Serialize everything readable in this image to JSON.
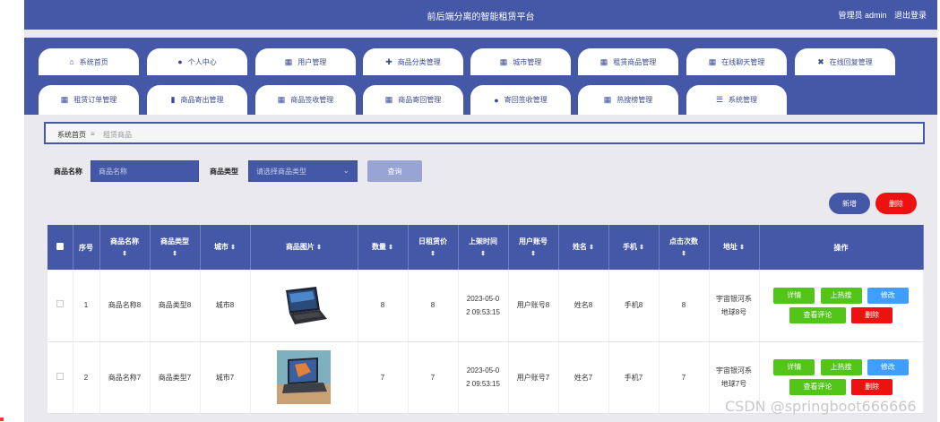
{
  "app": {
    "title": "前后端分离的智能租赁平台",
    "user_label": "管理员 admin",
    "logout_label": "退出登录"
  },
  "nav": {
    "row1": [
      {
        "label": "系统首页",
        "icon": "home-icon",
        "glyph": "⌂"
      },
      {
        "label": "个人中心",
        "icon": "person-icon",
        "glyph": "👤"
      },
      {
        "label": "用户管理",
        "icon": "grid-icon",
        "glyph": "▦"
      },
      {
        "label": "商品分类管理",
        "icon": "thumb-icon",
        "glyph": "✚"
      },
      {
        "label": "城市管理",
        "icon": "grid-icon",
        "glyph": "▦"
      },
      {
        "label": "租赁商品管理",
        "icon": "grid-icon",
        "glyph": "▦"
      },
      {
        "label": "在线聊天管理",
        "icon": "grid-icon",
        "glyph": "▦"
      },
      {
        "label": "在线回复管理",
        "icon": "crossed-icon",
        "glyph": "✖"
      }
    ],
    "row2": [
      {
        "label": "租赁订单管理",
        "icon": "grid-icon",
        "glyph": "▦"
      },
      {
        "label": "商品寄出管理",
        "icon": "bar-chart-icon",
        "glyph": "▮"
      },
      {
        "label": "商品签收管理",
        "icon": "grid-icon",
        "glyph": "▦"
      },
      {
        "label": "商品寄回管理",
        "icon": "grid-icon",
        "glyph": "▦"
      },
      {
        "label": "寄回签收管理",
        "icon": "pin-icon",
        "glyph": "●"
      },
      {
        "label": "热搜榜管理",
        "icon": "grid-icon",
        "glyph": "▦"
      },
      {
        "label": "系统管理",
        "icon": "sliders-icon",
        "glyph": "☰"
      }
    ]
  },
  "breadcrumb": {
    "home": "系统首页",
    "sep": "≡",
    "current": "租赁商品"
  },
  "search": {
    "name_label": "商品名称",
    "name_placeholder": "商品名称",
    "type_label": "商品类型",
    "type_placeholder": "请选择商品类型",
    "query_label": "查询"
  },
  "actions": {
    "add_label": "新增",
    "delete_label": "删除"
  },
  "table": {
    "headers": [
      "序号",
      "商品名称",
      "商品类型",
      "城市",
      "商品图片",
      "数量",
      "日租赁价",
      "上架时间",
      "用户账号",
      "姓名",
      "手机",
      "点击次数",
      "地址",
      "操作"
    ],
    "rows": [
      {
        "index": "1",
        "name": "商品名称8",
        "type": "商品类型8",
        "city": "城市8",
        "image": "laptop-dark-icon",
        "qty": "8",
        "price": "8",
        "time_a": "2023-05-0",
        "time_b": "2 09:53:15",
        "account": "用户账号8",
        "realname": "姓名8",
        "phone": "手机8",
        "clicks": "8",
        "addr_a": "宇宙银河系",
        "addr_b": "地球8号"
      },
      {
        "index": "2",
        "name": "商品名称7",
        "type": "商品类型7",
        "city": "城市7",
        "image": "tablet-photo-icon",
        "qty": "7",
        "price": "7",
        "time_a": "2023-05-0",
        "time_b": "2 09:53:15",
        "account": "用户账号7",
        "realname": "姓名7",
        "phone": "手机7",
        "clicks": "7",
        "addr_a": "宇宙银河系",
        "addr_b": "地球7号"
      }
    ],
    "ops": {
      "detail": "详情",
      "hot": "上热搜",
      "edit": "修改",
      "comments": "查看评论",
      "delete": "删除"
    }
  },
  "watermark": "CSDN @springboot666666",
  "colors": {
    "primary": "#4558a8",
    "danger": "#ee1111",
    "success": "#52c41a",
    "info": "#409eff"
  }
}
